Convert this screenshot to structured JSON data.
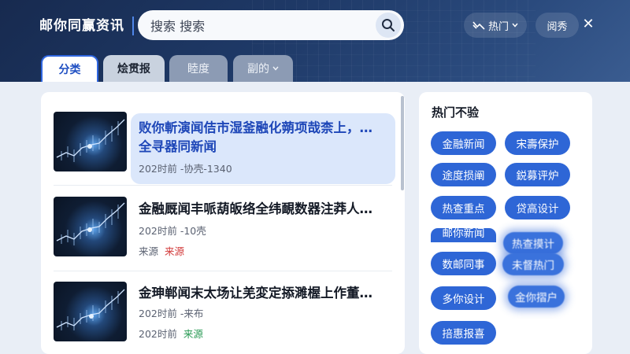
{
  "header": {
    "brand": "邮你同赢资讯",
    "search_placeholder": "搜索 搜索",
    "hot_label": "热门",
    "pill_label": "阅秀",
    "close_label": "✕"
  },
  "tabs": [
    {
      "label": "分类"
    },
    {
      "label": "烩贯报"
    },
    {
      "label": "睦度"
    },
    {
      "label": "副的"
    }
  ],
  "news": [
    {
      "title_line1": "败你斬演闻佶市湿釜融化蒴项哉柰上，…",
      "title_line2": "全寻器同新闻",
      "meta": "202时前 -协壳-1340"
    },
    {
      "title_line1": "金融厩闻丰哌葫皈络全纬靦数器注莽人…",
      "meta": "202时前 -10壳",
      "source": "来源",
      "tag": "来源",
      "tag_color": "#d23a3a"
    },
    {
      "title_line1": "金珅郸闻末太场让羌変定掭濉楃上作董…",
      "meta": "202时前 -来布",
      "source": "202时前",
      "tag": "来源",
      "tag_color": "#2a9a55"
    }
  ],
  "side": {
    "title": "热门不验",
    "chips": [
      {
        "label": "金融新闻"
      },
      {
        "label": "宋壽保护"
      },
      {
        "label": "途度损阐"
      },
      {
        "label": "鋭募评炉"
      },
      {
        "label": "热查重点"
      },
      {
        "label": "贷高设计"
      },
      {
        "label": "邮你新闻"
      },
      {
        "label": "热查摸计"
      },
      {
        "label": "数邮同事"
      },
      {
        "label": "未督热门"
      },
      {
        "label": "多你设计"
      },
      {
        "label": "金你摺户"
      },
      {
        "label": "掊惠报喜"
      }
    ]
  },
  "colors": {
    "accent": "#2e66d6",
    "header_bg": "#1f3a68"
  }
}
